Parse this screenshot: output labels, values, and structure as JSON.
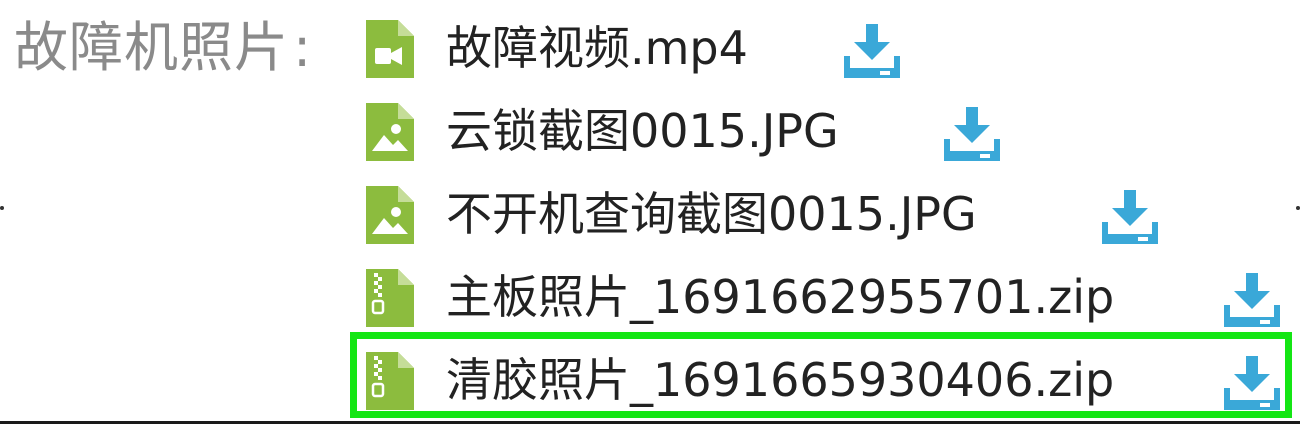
{
  "field": {
    "label": "故障机照片",
    "colon": ":"
  },
  "files": [
    {
      "name": "故障视频.mp4",
      "type": "video",
      "icon": "video-file-icon",
      "action": "download-icon"
    },
    {
      "name": "云锁截图0015.JPG",
      "type": "image",
      "icon": "image-file-icon",
      "action": "download-icon"
    },
    {
      "name": "不开机查询截图0015.JPG",
      "type": "image",
      "icon": "image-file-icon",
      "action": "download-icon"
    },
    {
      "name": "主板照片_1691662955701.zip",
      "type": "zip",
      "icon": "zip-file-icon",
      "action": "download-icon"
    },
    {
      "name": "清胶照片_1691665930406.zip",
      "type": "zip",
      "icon": "zip-file-icon",
      "action": "download-icon",
      "highlighted": true
    }
  ],
  "colors": {
    "file_icon": "#8cbc3e",
    "download_icon": "#3aa8d8",
    "highlight": "#14e614",
    "label": "#8a8a8a"
  }
}
